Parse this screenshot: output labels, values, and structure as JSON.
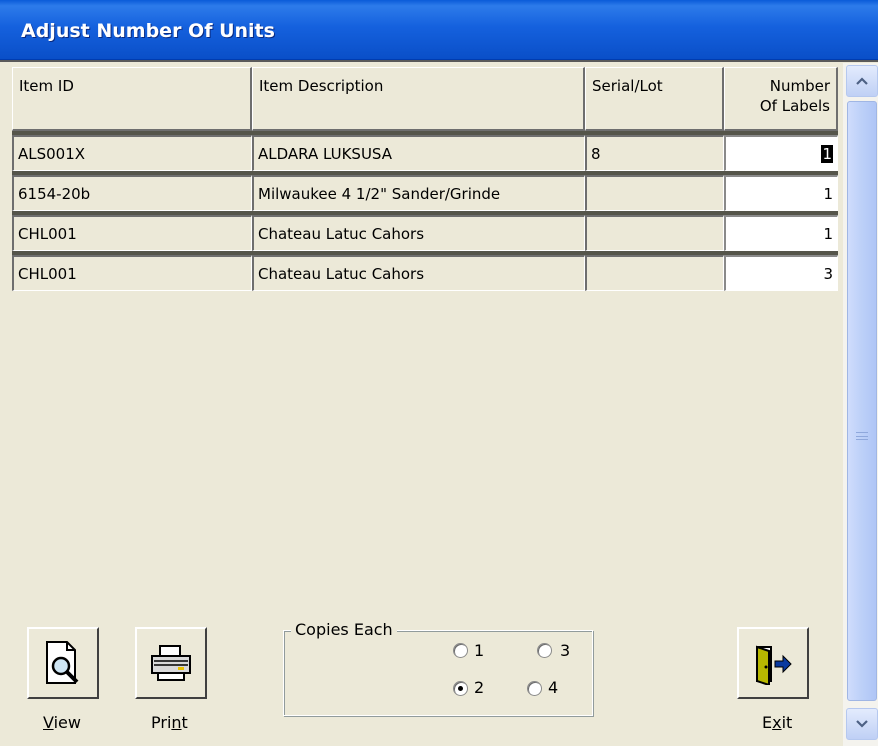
{
  "window": {
    "title": "Adjust Number Of Units"
  },
  "grid": {
    "headers": {
      "item_id": "Item ID",
      "item_description": "Item Description",
      "serial_lot": "Serial/Lot",
      "number_of_labels_line1": "Number",
      "number_of_labels_line2": "Of Labels"
    },
    "rows": [
      {
        "item_id": "ALS001X",
        "description": "ALDARA LUKSUSA",
        "serial": "8",
        "labels": "1"
      },
      {
        "item_id": "6154-20b",
        "description": "Milwaukee  4 1/2\" Sander/Grinde",
        "serial": "",
        "labels": "1"
      },
      {
        "item_id": "CHL001",
        "description": "Chateau Latuc Cahors",
        "serial": "",
        "labels": "1"
      },
      {
        "item_id": "CHL001",
        "description": "Chateau Latuc Cahors",
        "serial": "",
        "labels": "3"
      }
    ]
  },
  "buttons": {
    "view_label_accel": "V",
    "view_label_rest": "iew",
    "print_label_pre": "Pri",
    "print_label_accel": "n",
    "print_label_post": "t",
    "exit_label_pre": "E",
    "exit_label_accel": "x",
    "exit_label_post": "it"
  },
  "copies": {
    "legend": "Copies Each",
    "options": [
      "1",
      "3",
      "2",
      "4"
    ],
    "selected": "2"
  },
  "icons": {
    "view": "magnifier-document-icon",
    "print": "printer-icon",
    "exit": "exit-door-icon"
  }
}
